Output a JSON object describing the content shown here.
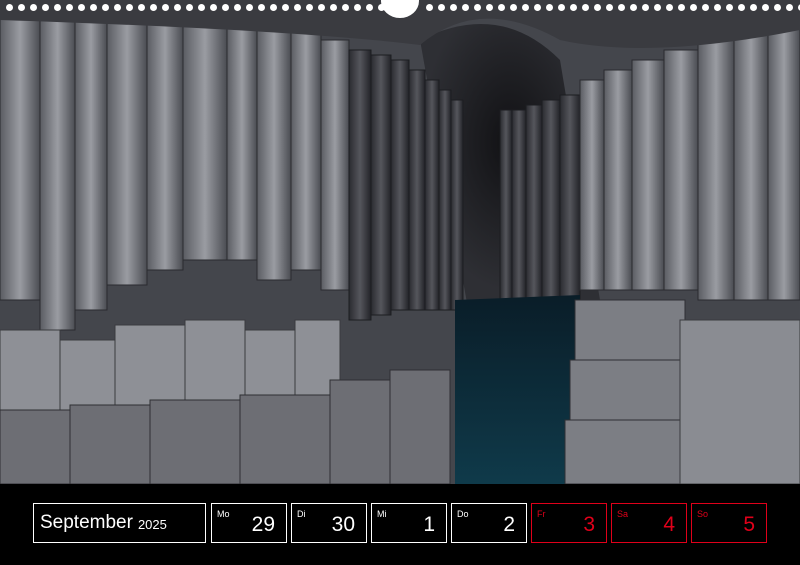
{
  "month": {
    "name": "September",
    "year": "2025"
  },
  "days": [
    {
      "dow": "Mo",
      "num": "29",
      "weekend": false
    },
    {
      "dow": "Di",
      "num": "30",
      "weekend": false
    },
    {
      "dow": "Mi",
      "num": "1",
      "weekend": false
    },
    {
      "dow": "Do",
      "num": "2",
      "weekend": false
    },
    {
      "dow": "Fr",
      "num": "3",
      "weekend": true
    },
    {
      "dow": "Sa",
      "num": "4",
      "weekend": true
    },
    {
      "dow": "So",
      "num": "5",
      "weekend": true
    }
  ],
  "colors": {
    "background": "#000000",
    "weekend": "#e0001a",
    "text": "#ffffff"
  }
}
